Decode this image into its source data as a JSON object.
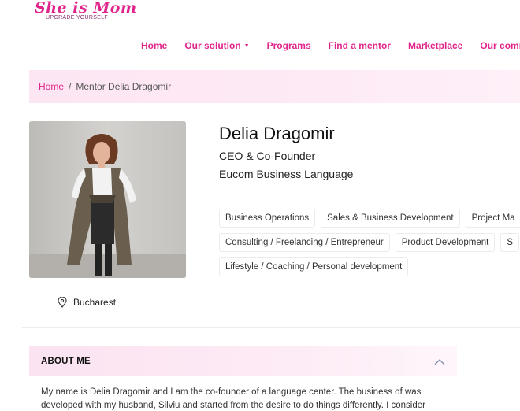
{
  "brand": {
    "name": "She is Mom",
    "tagline": "UPGRADE YOURSELF"
  },
  "nav": {
    "items": [
      {
        "label": "Home"
      },
      {
        "label": "Our solution",
        "has_dropdown": true
      },
      {
        "label": "Programs"
      },
      {
        "label": "Find a mentor"
      },
      {
        "label": "Marketplace"
      },
      {
        "label": "Our commu"
      }
    ]
  },
  "breadcrumb": {
    "home": "Home",
    "separator": "/",
    "current": "Mentor Delia Dragomir"
  },
  "profile": {
    "name": "Delia Dragomir",
    "role": "CEO & Co-Founder",
    "company": "Eucom Business Language",
    "location": "Bucharest",
    "tags": [
      "Business Operations",
      "Sales & Business Development",
      "Project Ma",
      "Consulting / Freelancing / Entrepreneur",
      "Product Development",
      "S",
      "Lifestyle / Coaching / Personal development"
    ]
  },
  "about": {
    "title": "ABOUT ME",
    "text": "My name is Delia Dragomir and I am the co-founder of a language center. The business of was developed with my husband, Silviu and started from the desire to do things differently. I consider"
  },
  "colors": {
    "accent": "#e0248a",
    "band": "#fde6f3"
  },
  "icons": {
    "location": "map-pin-icon",
    "collapse": "chevron-up-icon",
    "dropdown": "caret-down-icon"
  }
}
